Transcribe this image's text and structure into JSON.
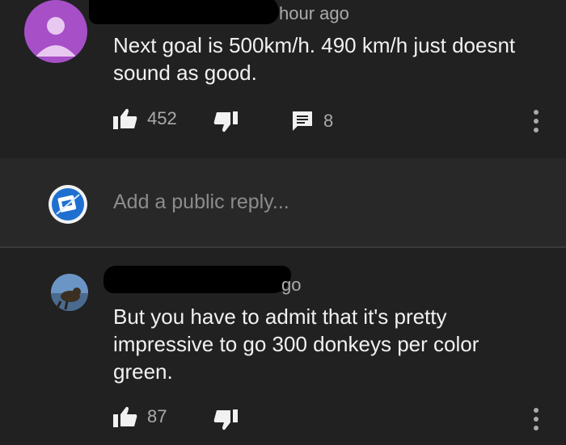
{
  "comments": [
    {
      "author_suffix": "hour ago",
      "text": "Next goal is 500km/h. 490 km/h just doesnt sound as good.",
      "likes": "452",
      "replies": "8"
    },
    {
      "author_suffix": "go",
      "text": "But you have to admit that it's pretty impressive to go 300 donkeys per color green.",
      "likes": "87"
    }
  ],
  "reply_box": {
    "placeholder": "Add a public reply..."
  },
  "colors": {
    "background": "#212121",
    "reply_bg": "#282828",
    "avatar_purple": "#a64fc7",
    "secondary_text": "#aaaaaa"
  },
  "icons": [
    "thumbs-up-icon",
    "thumbs-down-icon",
    "reply-icon",
    "more-vert-icon",
    "avatar-icon"
  ]
}
